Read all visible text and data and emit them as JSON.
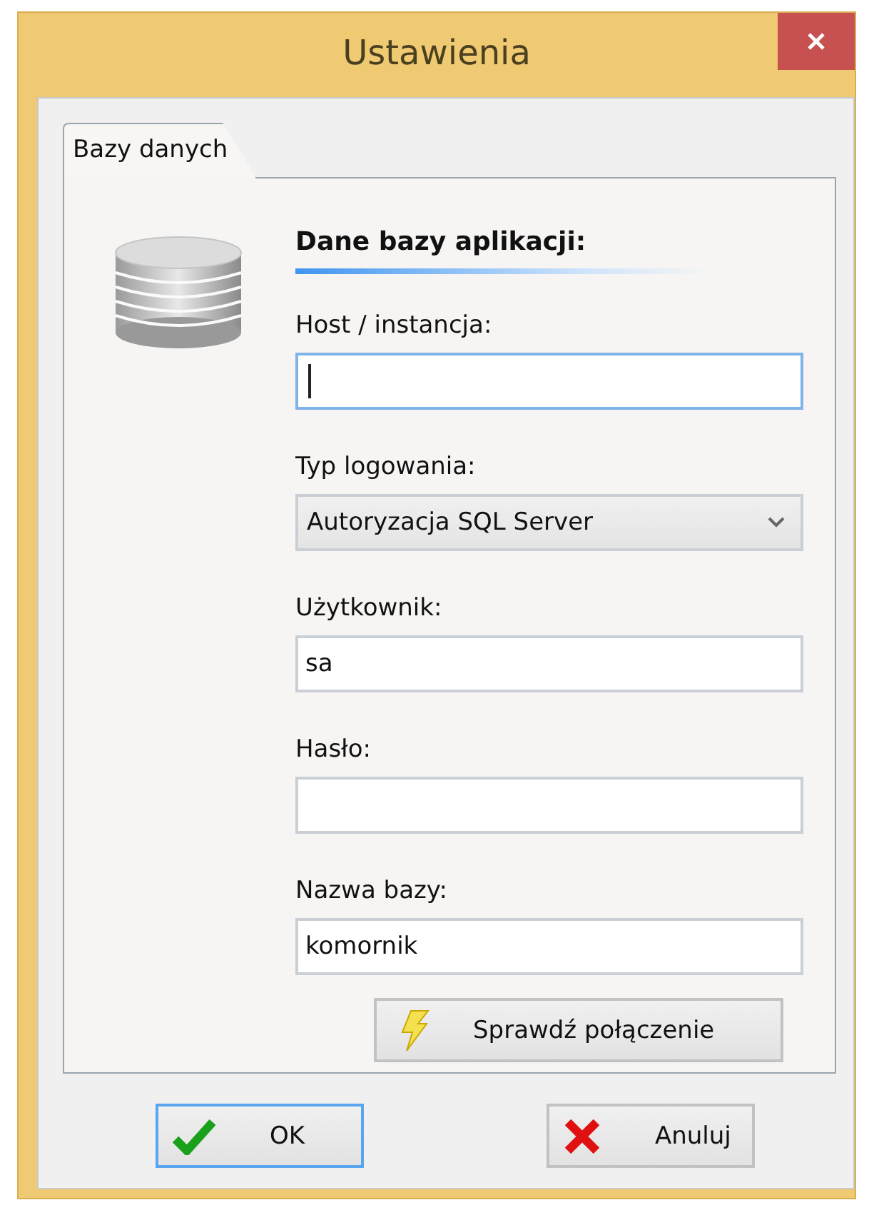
{
  "window": {
    "title": "Ustawienia"
  },
  "tabs": [
    {
      "label": "Bazy danych",
      "selected": true
    }
  ],
  "section": {
    "heading": "Dane bazy aplikacji:"
  },
  "fields": [
    {
      "kind": "text",
      "label": "Host / instancja:",
      "focused": true
    },
    {
      "kind": "select",
      "label": "Typ logowania:",
      "value": "Autoryzacja SQL Server",
      "focused": false
    },
    {
      "kind": "text",
      "label": "Użytkownik:",
      "value": "sa",
      "focused": false
    },
    {
      "kind": "text",
      "label": "Hasło:",
      "focused": false
    },
    {
      "kind": "text",
      "label": "Nazwa bazy:",
      "value": "komornik",
      "focused": false
    }
  ],
  "test_button": {
    "label": "Sprawdź połączenie"
  },
  "buttons": [
    {
      "kind": "ok",
      "label": "OK",
      "focused": true
    },
    {
      "kind": "cancel",
      "label": "Anuluj",
      "focused": false
    }
  ]
}
